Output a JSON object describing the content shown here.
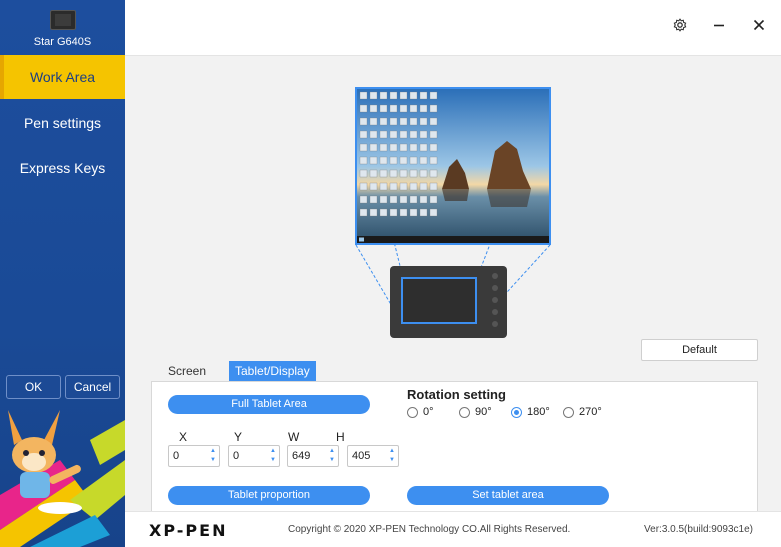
{
  "device": {
    "name": "Star G640S"
  },
  "sidebar": {
    "items": [
      {
        "label": "Work Area",
        "active": true
      },
      {
        "label": "Pen settings",
        "active": false
      },
      {
        "label": "Express Keys",
        "active": false
      }
    ],
    "ok_label": "OK",
    "cancel_label": "Cancel"
  },
  "topbar": {
    "icons": [
      "gear-icon",
      "minimize-icon",
      "close-icon"
    ]
  },
  "main": {
    "default_label": "Default",
    "tabs": [
      {
        "label": "Screen",
        "active": false
      },
      {
        "label": "Tablet/Display",
        "active": true
      }
    ],
    "full_area_label": "Full Tablet Area",
    "fields": [
      {
        "label": "X",
        "value": "0"
      },
      {
        "label": "Y",
        "value": "0"
      },
      {
        "label": "W",
        "value": "649"
      },
      {
        "label": "H",
        "value": "405"
      }
    ],
    "rotation_title": "Rotation setting",
    "rotations": [
      {
        "label": "0°",
        "checked": false
      },
      {
        "label": "90°",
        "checked": false
      },
      {
        "label": "180°",
        "checked": true
      },
      {
        "label": "270°",
        "checked": false
      }
    ],
    "tablet_proportion_label": "Tablet proportion",
    "set_tablet_area_label": "Set tablet area"
  },
  "footer": {
    "logo": "XP-PEN",
    "copyright": "Copyright © 2020 XP-PEN Technology CO.All Rights Reserved.",
    "version": "Ver:3.0.5(build:9093c1e)"
  },
  "colors": {
    "accent": "#3d8ff0",
    "sidebar": "#1d4e9e",
    "active_nav": "#f5c400"
  }
}
